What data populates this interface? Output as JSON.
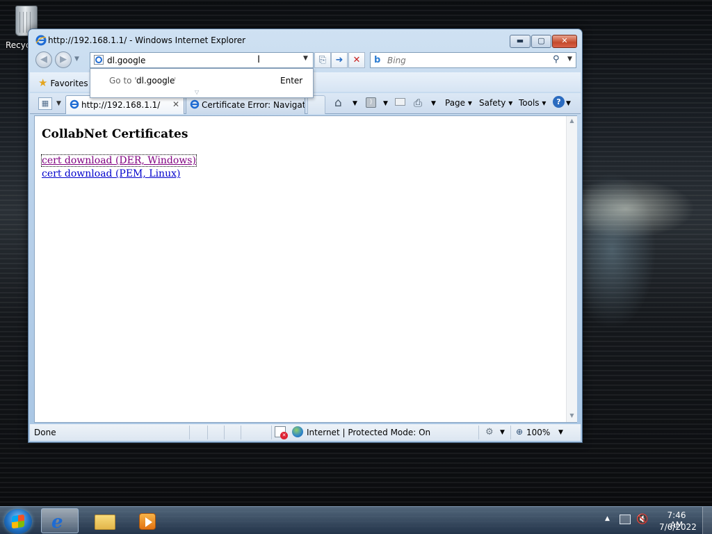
{
  "desktop": {
    "recycle_bin_label": "Recycle Bin"
  },
  "window": {
    "title": "http://192.168.1.1/ - Windows Internet Explorer",
    "minimize": "▬",
    "maximize": "▢",
    "close": "✕"
  },
  "address_bar": {
    "value": "dl.google",
    "autocomplete": {
      "goto_prefix": "Go to '",
      "goto_value": "dl.google",
      "goto_suffix": "'",
      "enter_hint": "Enter"
    }
  },
  "search_bar": {
    "placeholder": "Bing"
  },
  "favorites_bar": {
    "favorites_label": "Favorites"
  },
  "tabs": [
    {
      "label": "http://192.168.1.1/",
      "active": true
    },
    {
      "label": "Certificate Error: Navigati...",
      "active": false
    }
  ],
  "command_bar": {
    "page_label": "Page ▾",
    "safety_label": "Safety ▾",
    "tools_label": "Tools ▾",
    "help_label": "?"
  },
  "page": {
    "heading": "CollabNet Certificates",
    "links": [
      {
        "label": "cert download (DER, Windows)",
        "visited": true,
        "focused": true
      },
      {
        "label": "cert download (PEM, Linux)",
        "visited": false,
        "focused": false
      }
    ]
  },
  "status_bar": {
    "status": "Done",
    "zone": "Internet | Protected Mode: On",
    "zoom": "100%"
  },
  "taskbar": {
    "time": "7:46 AM",
    "date": "7/6/2022"
  },
  "colors": {
    "link_visited": "#800080",
    "link_unvisited": "#0000cc",
    "ie_blue": "#1e6bd3"
  },
  "icons": [
    "recycle-bin-icon",
    "ie-icon",
    "back-icon",
    "forward-icon",
    "compat-view-icon",
    "go-icon",
    "stop-icon",
    "bing-icon",
    "search-icon",
    "star-icon",
    "quick-tabs-icon",
    "home-icon",
    "feeds-icon",
    "mail-icon",
    "print-icon",
    "help-icon",
    "globe-icon",
    "zoom-icon",
    "windows-start-icon",
    "folder-icon",
    "media-player-icon",
    "network-icon",
    "volume-muted-icon"
  ]
}
